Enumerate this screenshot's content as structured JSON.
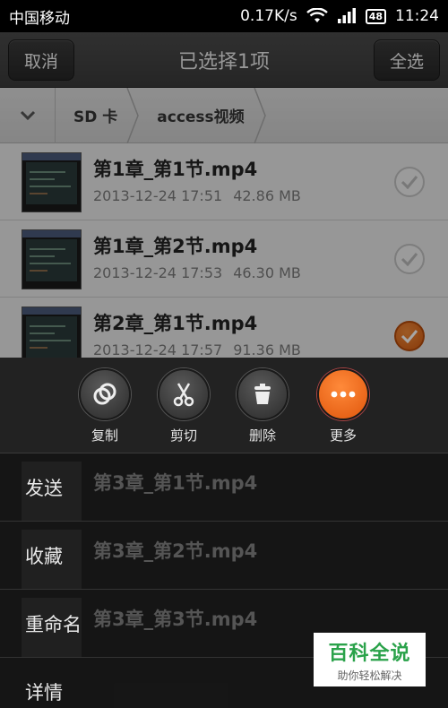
{
  "status": {
    "carrier": "中国移动",
    "speed": "0.17K/s",
    "battery": "48",
    "time": "11:24"
  },
  "header": {
    "cancel_label": "取消",
    "title": "已选择1项",
    "select_all_label": "全选"
  },
  "breadcrumb": {
    "items": [
      "SD 卡",
      "access视频"
    ]
  },
  "files": [
    {
      "name": "第1章_第1节.mp4",
      "date": "2013-12-24 17:51",
      "size": "42.86 MB",
      "checked": false
    },
    {
      "name": "第1章_第2节.mp4",
      "date": "2013-12-24 17:53",
      "size": "46.30 MB",
      "checked": false
    },
    {
      "name": "第2章_第1节.mp4",
      "date": "2013-12-24 17:57",
      "size": "91.36 MB",
      "checked": true
    }
  ],
  "background_files": [
    {
      "name": "第3章_第1节.mp4"
    },
    {
      "name": "第3章_第2节.mp4"
    },
    {
      "name": "第3章_第3节.mp4"
    }
  ],
  "actions": [
    {
      "label": "复制",
      "icon": "copy-icon"
    },
    {
      "label": "剪切",
      "icon": "scissors-icon"
    },
    {
      "label": "删除",
      "icon": "trash-icon"
    },
    {
      "label": "更多",
      "icon": "more-icon"
    }
  ],
  "menu": {
    "items": [
      "发送",
      "收藏",
      "重命名",
      "详情"
    ]
  },
  "watermark": {
    "title": "百科全说",
    "subtitle": "助你轻松解决"
  },
  "colors": {
    "accent": "#e0560c",
    "check_off": "#c0c0c0"
  }
}
